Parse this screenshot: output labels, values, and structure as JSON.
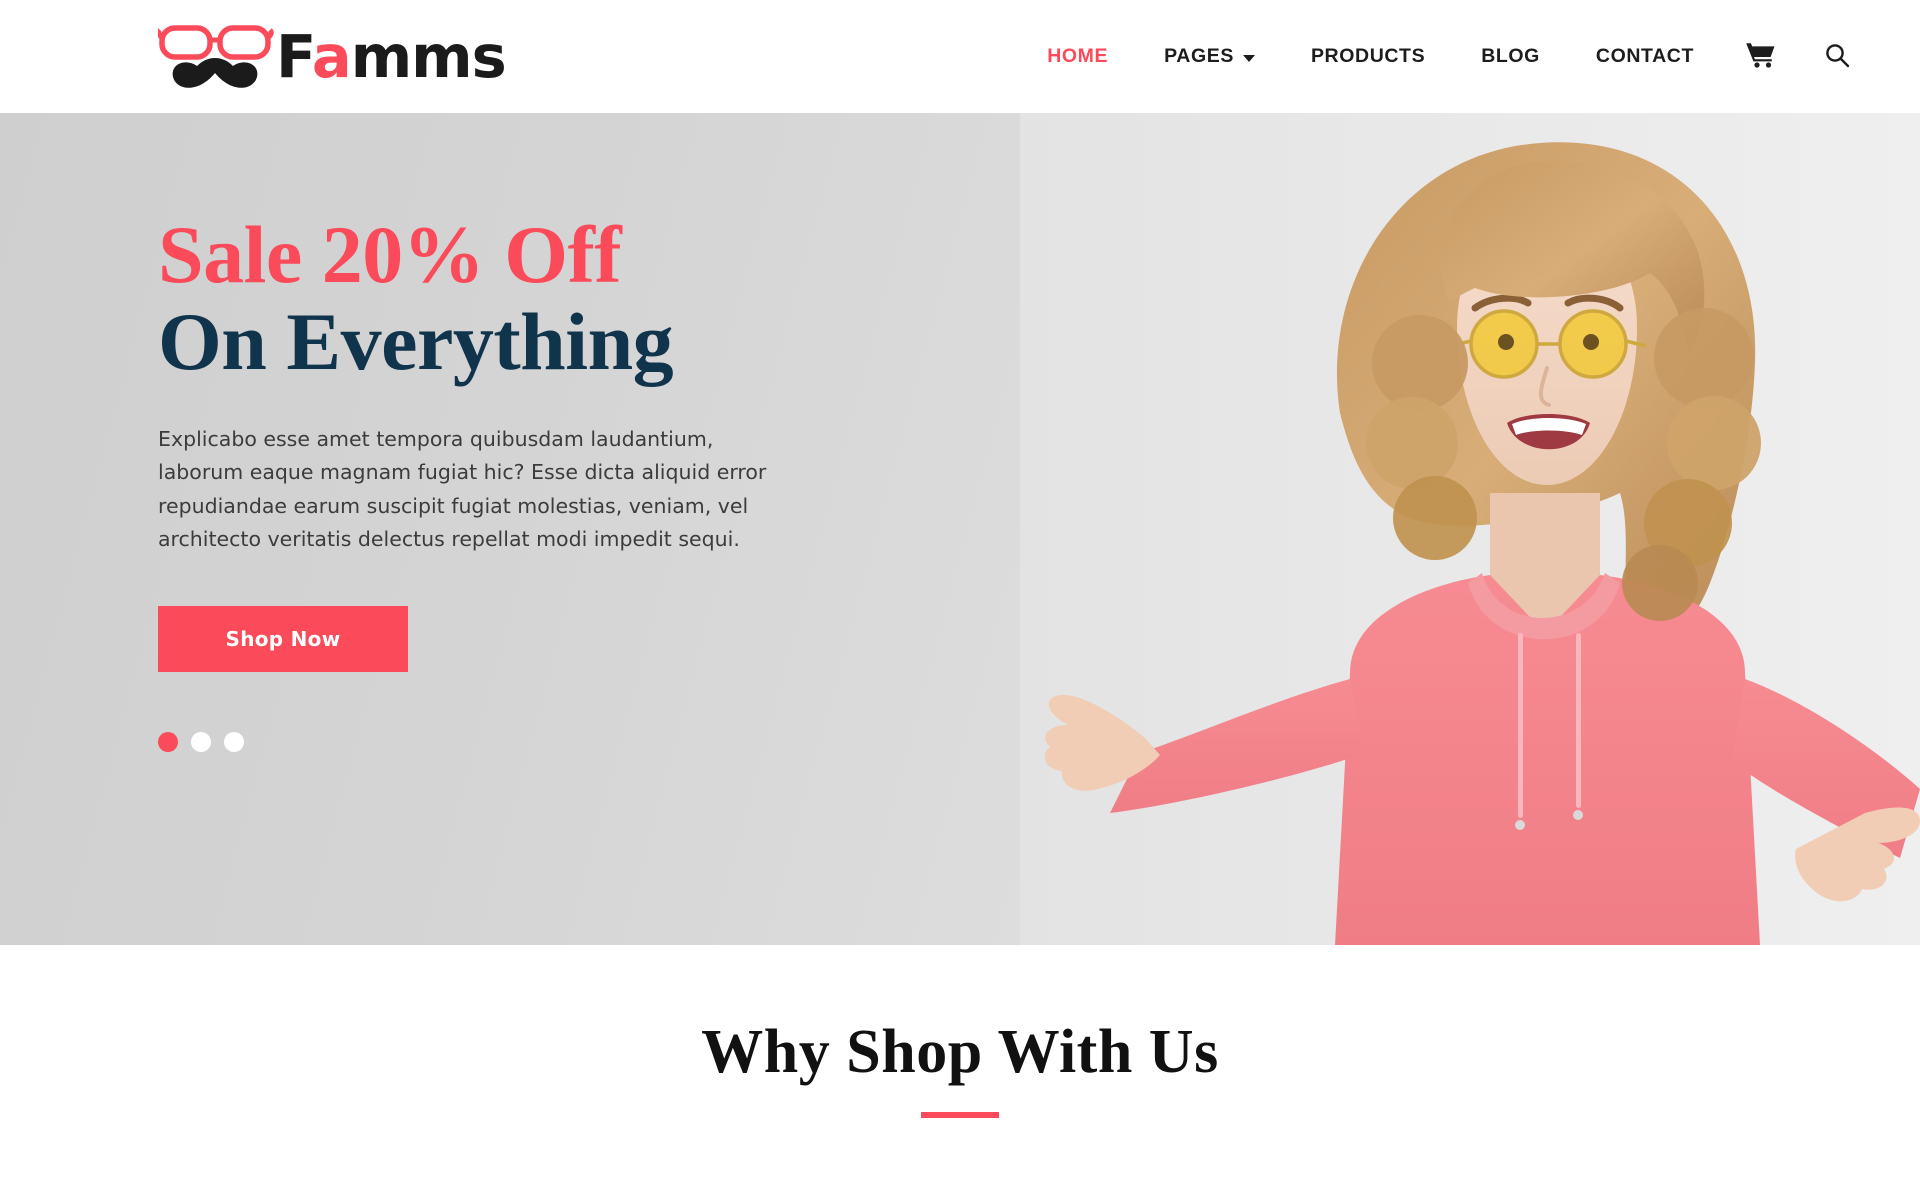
{
  "brand": {
    "name_part1": "F",
    "name_accent": "a",
    "name_part2": "mms",
    "logo_glasses_color": "#fb4a59",
    "logo_mustache_color": "#1b1b1b"
  },
  "header": {
    "nav": [
      {
        "label": "HOME",
        "active": true,
        "has_caret": false
      },
      {
        "label": "PAGES",
        "active": false,
        "has_caret": true
      },
      {
        "label": "PRODUCTS",
        "active": false,
        "has_caret": false
      },
      {
        "label": "BLOG",
        "active": false,
        "has_caret": false
      },
      {
        "label": "CONTACT",
        "active": false,
        "has_caret": false
      }
    ],
    "cart_icon": "cart-icon",
    "search_icon": "search-icon"
  },
  "hero": {
    "title_line1": "Sale 20% Off",
    "title_line2": "On Everything",
    "paragraph": "Explicabo esse amet tempora quibusdam laudantium, laborum eaque magnam fugiat hic? Esse dicta aliquid error repudiandae earum suscipit fugiat molestias, veniam, vel architecto veritatis delectus repellat modi impedit sequi.",
    "cta_label": "Shop Now",
    "slides": [
      {
        "index": 1,
        "active": true
      },
      {
        "index": 2,
        "active": false
      },
      {
        "index": 3,
        "active": false
      }
    ],
    "image_alt": "woman-pointing-photo",
    "title_color_line1": "#fb4a59",
    "title_color_line2": "#11344d",
    "background": "#d6d6d6"
  },
  "why_section": {
    "heading": "Why Shop With Us",
    "accent_color": "#fb4a59"
  }
}
